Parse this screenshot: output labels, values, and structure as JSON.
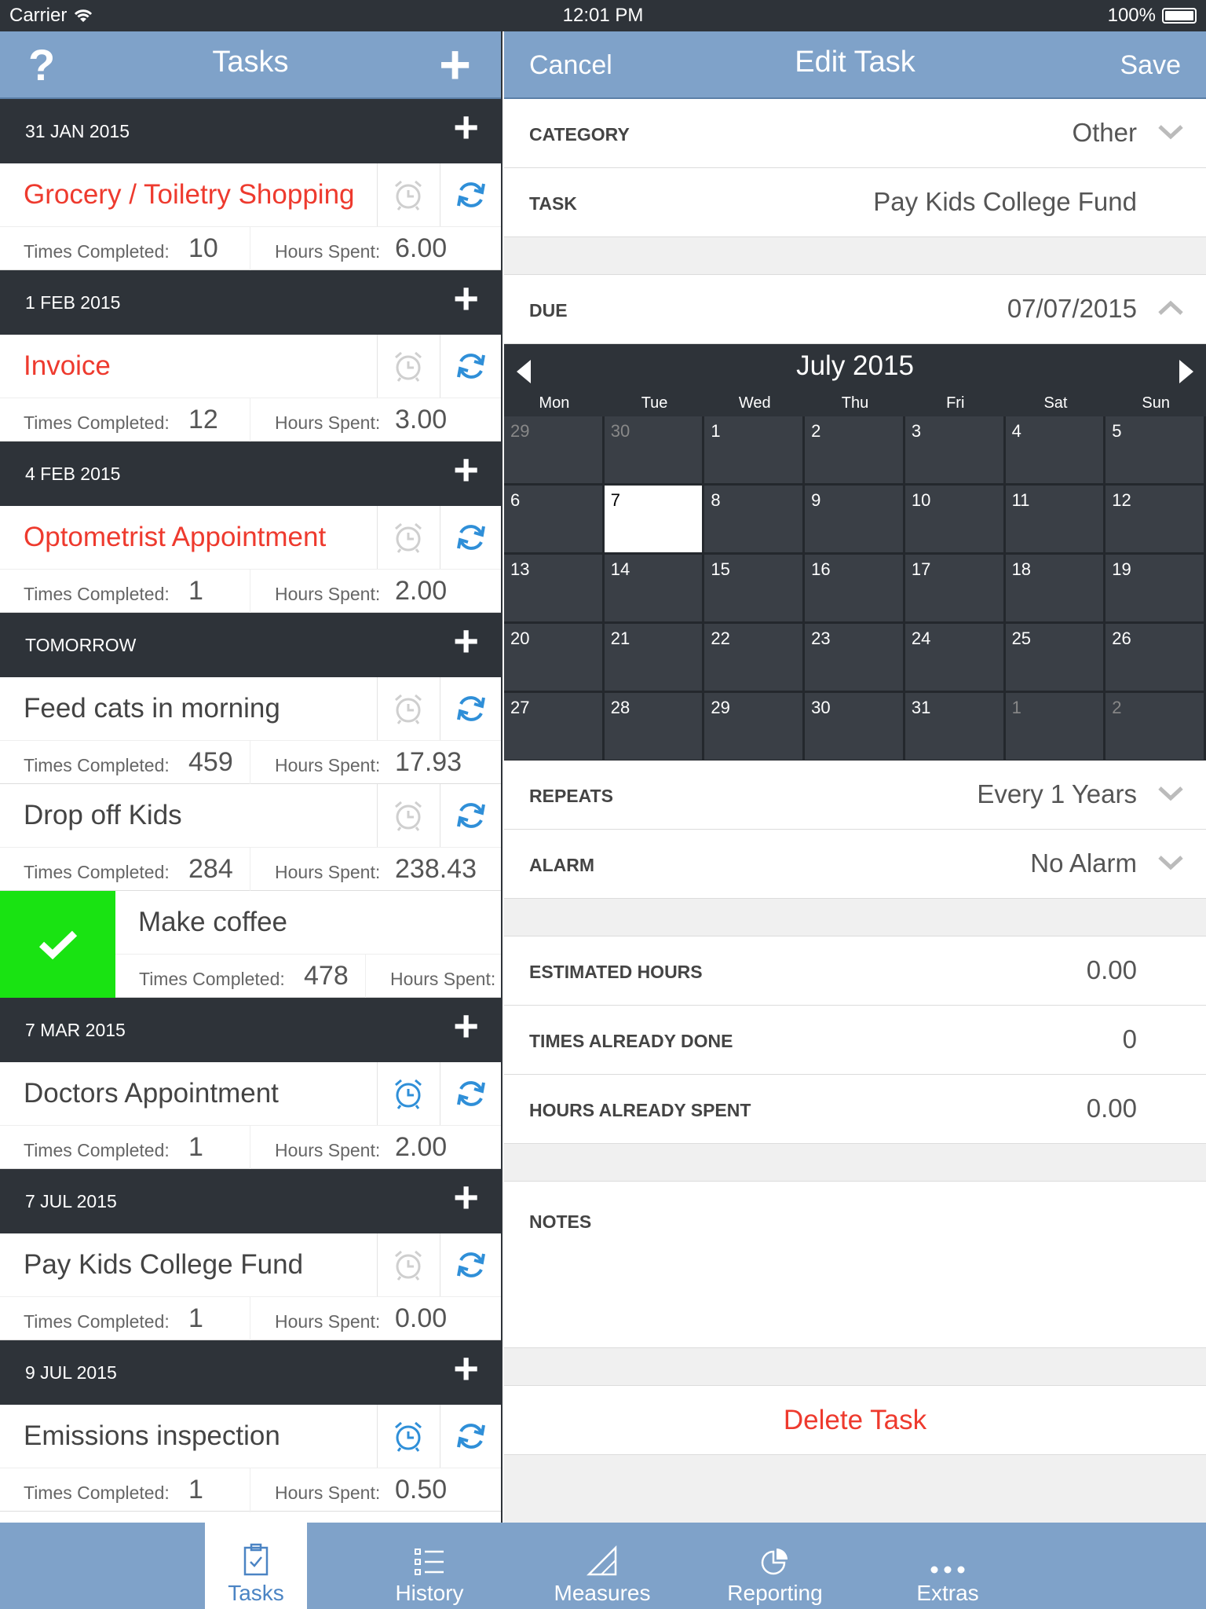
{
  "status_bar": {
    "carrier": "Carrier",
    "time": "12:01 PM",
    "battery": "100%"
  },
  "left_nav": {
    "title": "Tasks",
    "help_glyph": "?",
    "add_glyph": "+"
  },
  "groups": [
    {
      "date": "31 JAN 2015",
      "tasks": [
        {
          "name": "Grocery / Toiletry Shopping",
          "overdue": true,
          "alarm": false,
          "times_label": "Times Completed:",
          "times": "10",
          "hours_label": "Hours Spent:",
          "hours": "6.00"
        }
      ]
    },
    {
      "date": "1 FEB 2015",
      "tasks": [
        {
          "name": "Invoice",
          "overdue": true,
          "alarm": false,
          "times_label": "Times Completed:",
          "times": "12",
          "hours_label": "Hours Spent:",
          "hours": "3.00"
        }
      ]
    },
    {
      "date": "4 FEB 2015",
      "tasks": [
        {
          "name": "Optometrist Appointment",
          "overdue": true,
          "alarm": false,
          "times_label": "Times Completed:",
          "times": "1",
          "hours_label": "Hours Spent:",
          "hours": "2.00"
        }
      ]
    },
    {
      "date": "TOMORROW",
      "tasks": [
        {
          "name": "Feed cats in morning",
          "overdue": false,
          "alarm": false,
          "times_label": "Times Completed:",
          "times": "459",
          "hours_label": "Hours Spent:",
          "hours": "17.93"
        },
        {
          "name": "Drop off Kids",
          "overdue": false,
          "alarm": false,
          "times_label": "Times Completed:",
          "times": "284",
          "hours_label": "Hours Spent:",
          "hours": "238.43"
        },
        {
          "name": "Make coffee",
          "overdue": false,
          "done": true,
          "times_label": "Times Completed:",
          "times": "478",
          "hours_label": "Hours Spent:",
          "hours": ""
        }
      ]
    },
    {
      "date": "7 MAR 2015",
      "tasks": [
        {
          "name": "Doctors Appointment",
          "overdue": false,
          "alarm": true,
          "times_label": "Times Completed:",
          "times": "1",
          "hours_label": "Hours Spent:",
          "hours": "2.00"
        }
      ]
    },
    {
      "date": "7 JUL 2015",
      "tasks": [
        {
          "name": "Pay Kids College Fund",
          "overdue": false,
          "alarm": false,
          "times_label": "Times Completed:",
          "times": "1",
          "hours_label": "Hours Spent:",
          "hours": "0.00"
        }
      ]
    },
    {
      "date": "9 JUL 2015",
      "tasks": [
        {
          "name": "Emissions inspection",
          "overdue": false,
          "alarm": true,
          "times_label": "Times Completed:",
          "times": "1",
          "hours_label": "Hours Spent:",
          "hours": "0.50"
        }
      ]
    }
  ],
  "right_nav": {
    "cancel": "Cancel",
    "title": "Edit Task",
    "save": "Save"
  },
  "form": {
    "category": {
      "label": "CATEGORY",
      "value": "Other"
    },
    "task": {
      "label": "TASK",
      "value": "Pay Kids College Fund"
    },
    "due": {
      "label": "DUE",
      "value": "07/07/2015"
    },
    "repeats": {
      "label": "REPEATS",
      "value": "Every 1 Years"
    },
    "alarm": {
      "label": "ALARM",
      "value": "No Alarm"
    },
    "estimated_hours": {
      "label": "ESTIMATED HOURS",
      "value": "0.00"
    },
    "times_done": {
      "label": "TIMES ALREADY DONE",
      "value": "0"
    },
    "hours_spent": {
      "label": "HOURS ALREADY SPENT",
      "value": "0.00"
    },
    "notes": {
      "label": "NOTES"
    },
    "delete": "Delete Task"
  },
  "calendar": {
    "month": "July 2015",
    "weekdays": [
      "Mon",
      "Tue",
      "Wed",
      "Thu",
      "Fri",
      "Sat",
      "Sun"
    ],
    "days": [
      {
        "d": "29",
        "dim": true
      },
      {
        "d": "30",
        "dim": true
      },
      {
        "d": "1"
      },
      {
        "d": "2"
      },
      {
        "d": "3"
      },
      {
        "d": "4"
      },
      {
        "d": "5"
      },
      {
        "d": "6"
      },
      {
        "d": "7",
        "selected": true
      },
      {
        "d": "8"
      },
      {
        "d": "9"
      },
      {
        "d": "10"
      },
      {
        "d": "11"
      },
      {
        "d": "12"
      },
      {
        "d": "13"
      },
      {
        "d": "14"
      },
      {
        "d": "15"
      },
      {
        "d": "16"
      },
      {
        "d": "17"
      },
      {
        "d": "18"
      },
      {
        "d": "19"
      },
      {
        "d": "20"
      },
      {
        "d": "21"
      },
      {
        "d": "22"
      },
      {
        "d": "23"
      },
      {
        "d": "24"
      },
      {
        "d": "25"
      },
      {
        "d": "26"
      },
      {
        "d": "27"
      },
      {
        "d": "28"
      },
      {
        "d": "29"
      },
      {
        "d": "30"
      },
      {
        "d": "31"
      },
      {
        "d": "1",
        "dim": true
      },
      {
        "d": "2",
        "dim": true
      }
    ]
  },
  "tabs": [
    {
      "label": "Tasks",
      "icon": "clipboard-icon",
      "active": true
    },
    {
      "label": "History",
      "icon": "list-icon"
    },
    {
      "label": "Measures",
      "icon": "ruler-triangle-icon"
    },
    {
      "label": "Reporting",
      "icon": "pie-chart-icon"
    },
    {
      "label": "Extras",
      "icon": "more-dots-icon"
    }
  ],
  "colors": {
    "nav": "#7fa2c9",
    "dark": "#2e3339",
    "overdue": "#ee3a2e",
    "done": "#19e312",
    "accent": "#4b84c4"
  }
}
